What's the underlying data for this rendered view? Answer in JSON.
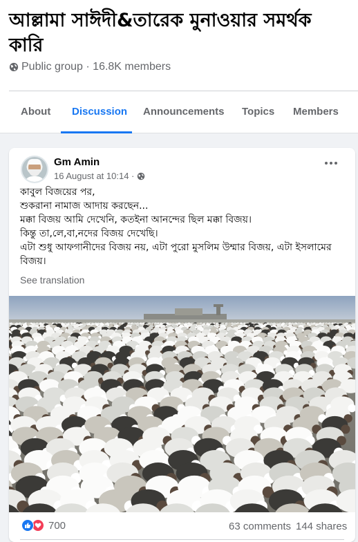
{
  "group": {
    "title": "আল্লামা সাঈদী&তারেক মুনাওয়ার সমর্থক কারি",
    "meta": "Public group · 16.8K members",
    "privacy_icon": "globe-icon"
  },
  "tabs": [
    {
      "label": "About",
      "active": false
    },
    {
      "label": "Discussion",
      "active": true
    },
    {
      "label": "Announcements",
      "active": false
    },
    {
      "label": "Topics",
      "active": false
    },
    {
      "label": "Members",
      "active": false
    }
  ],
  "post": {
    "author": "Gm Amin",
    "time": "16 August at 10:14 ·",
    "audience_icon": "globe-icon",
    "menu_icon": "more-dots-icon",
    "lines": [
      "কাবুল বিজয়ের পর,",
      "শুকরানা নামাজ আদায় করছেন...",
      "মক্কা বিজয় আমি দেখেনি, কতইনা আনন্দের ছিল মক্কা বিজয়।",
      "কিন্তু তা,লে,বা,নদের বিজয় দেখেছি।",
      "এটা শুধু আফগানীদের বিজয় নয়, এটা পুরো মুসলিম উম্মার বিজয়, এটা ইসলামের বিজয়।"
    ],
    "see_translation": "See translation",
    "photo": "crowd-praying-photo"
  },
  "stats": {
    "reaction_icons": [
      "like-icon",
      "love-icon"
    ],
    "reactions": "700",
    "comments": "63 comments",
    "shares": "144 shares"
  },
  "colors": {
    "accent": "#1877f2",
    "secondary_text": "#65676b",
    "background": "#f0f2f5",
    "love": "#f33e58"
  }
}
